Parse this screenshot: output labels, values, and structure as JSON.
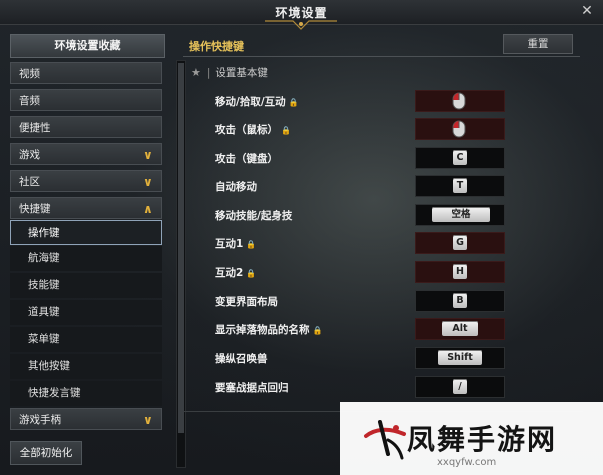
{
  "window": {
    "title": "环境设置"
  },
  "sidebar": {
    "favorites": "环境设置收藏",
    "categories": [
      {
        "label": "视频"
      },
      {
        "label": "音频"
      },
      {
        "label": "便捷性"
      },
      {
        "label": "游戏"
      },
      {
        "label": "社区"
      },
      {
        "label": "快捷键"
      }
    ],
    "subitems": [
      "操作键",
      "航海键",
      "技能键",
      "道具键",
      "菜单键",
      "其他按键",
      "快捷发言键"
    ],
    "gamepad": "游戏手柄",
    "reset_all": "全部初始化"
  },
  "main": {
    "title": "操作快捷键",
    "reset": "重置",
    "section": "设置基本键",
    "rows": [
      {
        "label": "移动/拾取/互动",
        "key": "",
        "locked": true
      },
      {
        "label": "攻击（鼠标）",
        "key": "",
        "locked": true
      },
      {
        "label": "攻击（键盘）",
        "key": "C",
        "locked": false
      },
      {
        "label": "自动移动",
        "key": "T",
        "locked": false
      },
      {
        "label": "移动技能/起身技",
        "key": "空格",
        "locked": false
      },
      {
        "label": "互动1",
        "key": "G",
        "locked": true
      },
      {
        "label": "互动2",
        "key": "H",
        "locked": true
      },
      {
        "label": "变更界面布局",
        "key": "B",
        "locked": false
      },
      {
        "label": "显示掉落物品的名称",
        "key": "Alt",
        "locked": true
      },
      {
        "label": "操纵召唤兽",
        "key": "Shift",
        "locked": false
      },
      {
        "label": "要塞战据点回归",
        "key": "/",
        "locked": false
      }
    ]
  },
  "watermark": {
    "text": "凤舞手游网",
    "url": "xxqyfw.com"
  },
  "colors": {
    "accent": "#e6c25a",
    "chevron": "#e2b13c"
  }
}
